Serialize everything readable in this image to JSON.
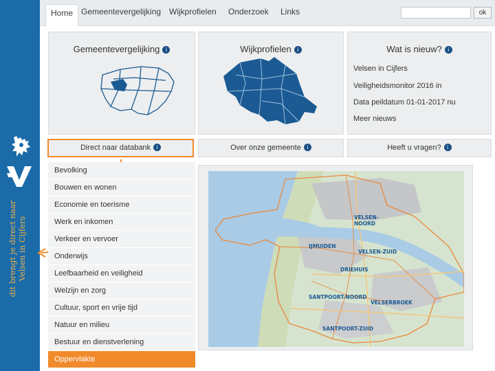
{
  "brand": {
    "side_text_line1": "dit brengt je direct naar",
    "side_text_line2": "Velsen in Cijfers"
  },
  "nav": {
    "tabs": [
      "Home",
      "Gemeentevergelijking",
      "Wijkprofielen",
      "Onderzoek",
      "Links"
    ],
    "search_placeholder": "",
    "ok_label": "ok"
  },
  "panels": {
    "gemeente_title": "Gemeentevergelijking",
    "wijk_title": "Wijkprofielen",
    "nieuw_title": "Wat is nieuw?",
    "news": [
      "Velsen in Cijfers",
      "Veiligheidsmonitor 2016 in",
      "Data peildatum 01-01-2017 nu",
      "Meer nieuws"
    ]
  },
  "bars": {
    "databank": "Direct naar databank",
    "gemeente": "Over onze gemeente",
    "vragen": "Heeft u vragen?"
  },
  "menu": [
    "Bevolking",
    "Bouwen en wonen",
    "Economie en toerisme",
    "Werk en inkomen",
    "Verkeer en vervoer",
    "Onderwijs",
    "Leefbaarheid en veiligheid",
    "Welzijn en zorg",
    "Cultuur, sport en vrije tijd",
    "Natuur en milieu",
    "Bestuur en dienstverlening",
    "Oppervlakte"
  ],
  "map_labels": {
    "velsen_noord": "VELSEN-\nNOORD",
    "ijmuiden": "IJMUIDEN",
    "velsen_zuid": "VELSEN-ZUID",
    "driehuis": "DRIEHUIS",
    "santpoort_noord": "SANTPOORT-NOORD",
    "velserbroek": "VELSERBROEK",
    "santpoort_zuid": "SANTPOORT-ZUID"
  },
  "colors": {
    "brand_blue": "#1a6ba8",
    "accent_orange": "#f08a2b",
    "map_region": "#1b5a92"
  }
}
